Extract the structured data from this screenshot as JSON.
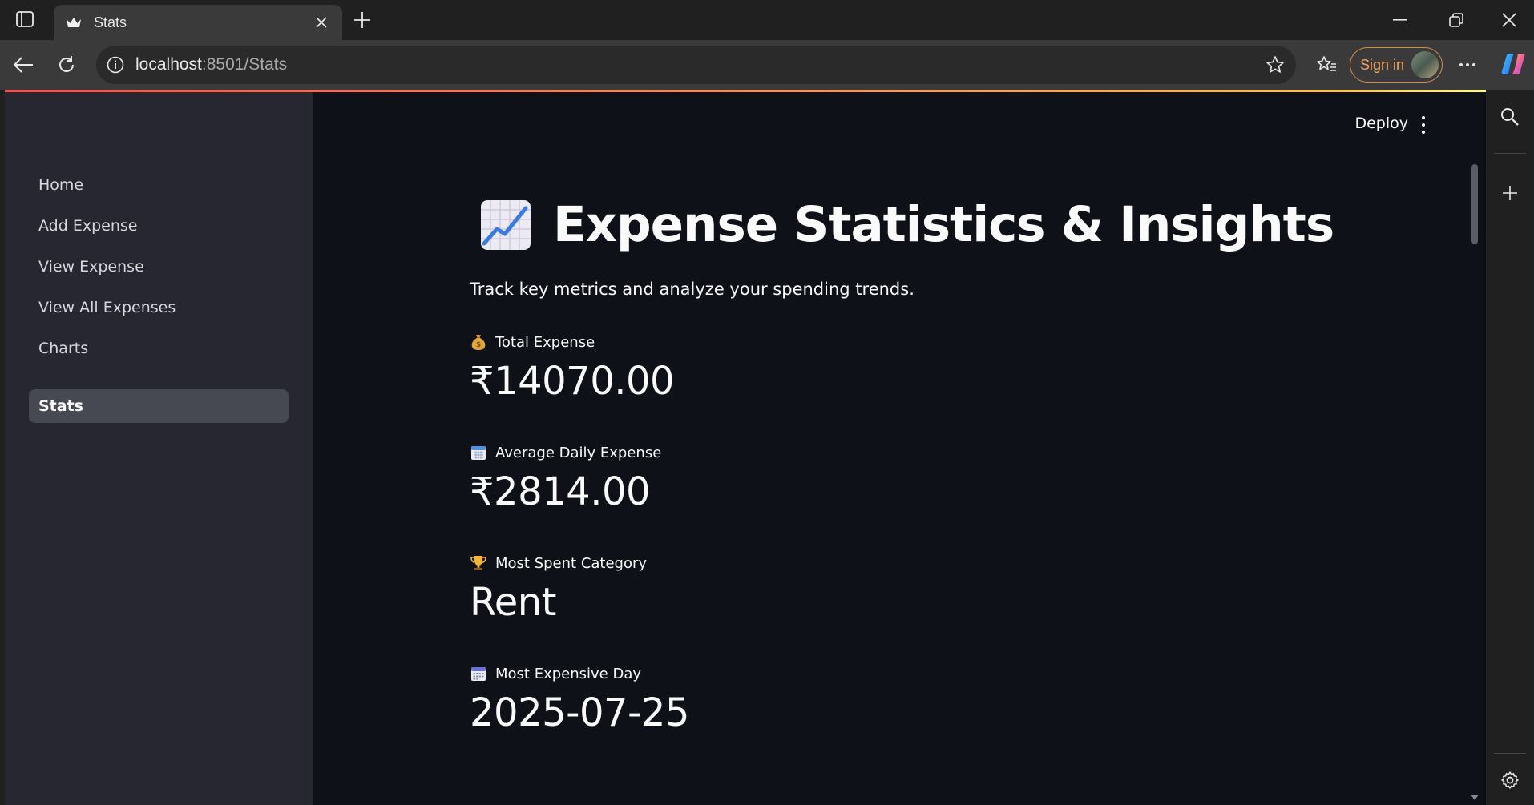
{
  "browser": {
    "tab": {
      "title": "Stats"
    },
    "address": {
      "host": "localhost",
      "rest": ":8501/Stats"
    },
    "signin_label": "Sign in"
  },
  "app": {
    "header": {
      "deploy_label": "Deploy"
    },
    "sidebar": {
      "items": [
        {
          "label": "Home",
          "active": false
        },
        {
          "label": "Add Expense",
          "active": false
        },
        {
          "label": "View Expense",
          "active": false
        },
        {
          "label": "View All Expenses",
          "active": false
        },
        {
          "label": "Charts",
          "active": false
        },
        {
          "label": "Stats",
          "active": true
        }
      ]
    },
    "page": {
      "title": "Expense Statistics & Insights",
      "title_icon": "chart-increasing-icon",
      "subtitle": "Track key metrics and analyze your spending trends."
    },
    "metrics": [
      {
        "icon": "money-bag-icon",
        "label": "Total Expense",
        "value": "₹14070.00"
      },
      {
        "icon": "calendar-icon",
        "label": "Average Daily Expense",
        "value": "₹2814.00"
      },
      {
        "icon": "trophy-icon",
        "label": "Most Spent Category",
        "value": "Rent"
      },
      {
        "icon": "calendar-grid-icon",
        "label": "Most Expensive Day",
        "value": "2025-07-25"
      }
    ]
  },
  "colors": {
    "app_background": "#0e1117",
    "sidebar_background": "#262730",
    "active_item_background": "#464852",
    "accent_line": "#ff4b4b",
    "signin_border": "#d98c46"
  }
}
